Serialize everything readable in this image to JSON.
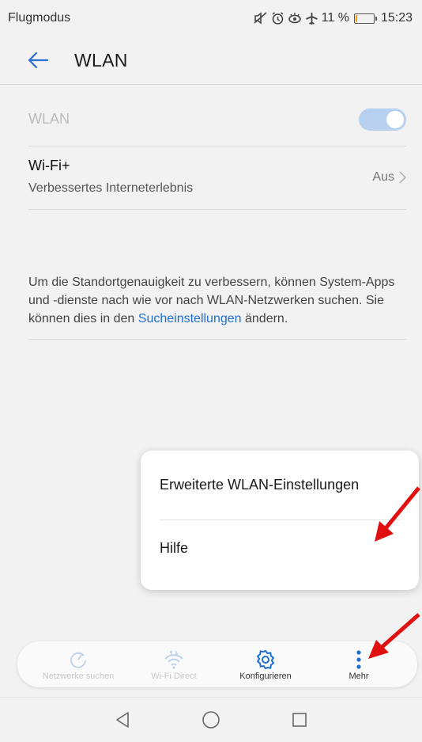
{
  "status": {
    "left": "Flugmodus",
    "battery_percent": "11 %",
    "battery_level": 0.11,
    "time": "15:23"
  },
  "header": {
    "title": "WLAN"
  },
  "settings": {
    "wlan_label": "WLAN",
    "wlan_toggle_on": true,
    "wifi_plus_title": "Wi-Fi+",
    "wifi_plus_subtitle": "Verbessertes Interneterlebnis",
    "wifi_plus_value": "Aus"
  },
  "info": {
    "text": "Um die Standortgenauigkeit zu verbessern, können System-Apps und -dienste nach wie vor nach WLAN-Netzwerken suchen. Sie können dies in den ",
    "link": "Sucheinstellungen",
    "suffix": " ändern."
  },
  "menu": {
    "items": [
      "Erweiterte WLAN-Einstellungen",
      "Hilfe"
    ]
  },
  "actions": [
    {
      "label": "Netzwerke suchen",
      "icon": "refresh-icon",
      "enabled": false
    },
    {
      "label": "Wi-Fi Direct",
      "icon": "wifi-direct-icon",
      "enabled": false
    },
    {
      "label": "Konfigurieren",
      "icon": "gear-icon",
      "enabled": true
    },
    {
      "label": "Mehr",
      "icon": "more-vertical-icon",
      "enabled": true
    }
  ],
  "colors": {
    "accent": "#1f6fcf",
    "annotation": "#e01010"
  }
}
